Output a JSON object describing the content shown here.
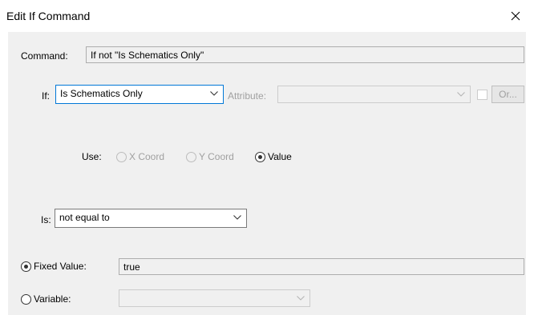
{
  "window": {
    "title": "Edit If Command",
    "close_icon": "close-icon"
  },
  "command": {
    "label": "Command:",
    "value": "If not \"Is Schematics Only\""
  },
  "if_row": {
    "label": "If:",
    "selected": "Is Schematics Only",
    "attribute_label": "Attribute:",
    "attribute_value": "",
    "attribute_enabled": false,
    "checkbox_checked": false,
    "or_button_label": "Or...",
    "or_button_enabled": false
  },
  "use_row": {
    "label": "Use:",
    "options": [
      {
        "label": "X Coord",
        "selected": false,
        "enabled": false
      },
      {
        "label": "Y Coord",
        "selected": false,
        "enabled": false
      },
      {
        "label": "Value",
        "selected": true,
        "enabled": true
      }
    ]
  },
  "is_row": {
    "label": "Is:",
    "selected": "not equal to"
  },
  "fixed_value": {
    "label": "Fixed Value:",
    "selected": true,
    "value": "true"
  },
  "variable": {
    "label": "Variable:",
    "selected": false,
    "value": "",
    "enabled": false
  },
  "colors": {
    "dialog_background": "#f0f0f0",
    "focus_border": "#0078d7",
    "disabled_text": "#a0a0a0"
  }
}
